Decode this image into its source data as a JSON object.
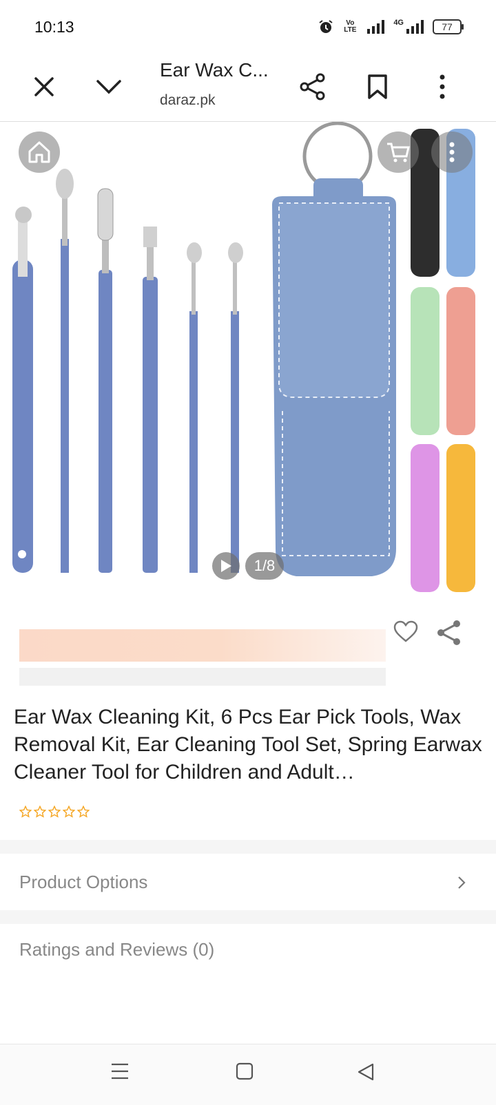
{
  "status_bar": {
    "time": "10:13",
    "volte": "Vo LTE",
    "network": "4G",
    "battery": "77"
  },
  "browser": {
    "title": "Ear Wax C...",
    "url": "daraz.pk"
  },
  "gallery": {
    "counter": "1/8"
  },
  "product": {
    "title": "Ear Wax Cleaning Kit, 6 Pcs Ear Pick Tools, Wax Removal Kit, Ear Cleaning Tool Set, Spring Earwax Cleaner Tool for Children and Adult…",
    "rating_stars": 0,
    "star_color": "#f5a623"
  },
  "sections": {
    "product_options": "Product Options",
    "ratings_reviews": "Ratings and Reviews (0)"
  },
  "colors": {
    "tool_blue": "#6f86c2",
    "pouch_blue": "#7f9bc9"
  }
}
